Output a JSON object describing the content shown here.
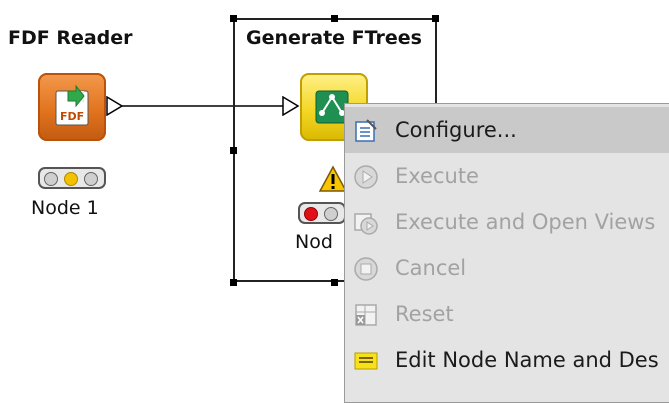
{
  "nodes": [
    {
      "title": "FDF Reader",
      "label": "Node 1",
      "icon_text": "FDF"
    },
    {
      "title": "Generate FTrees",
      "label_visible": "Nod"
    }
  ],
  "context_menu": {
    "items": [
      {
        "label": "Configure...",
        "icon": "configure-icon",
        "enabled": true,
        "highlighted": true
      },
      {
        "label": "Execute",
        "icon": "execute-icon",
        "enabled": false
      },
      {
        "label": "Execute and Open Views",
        "icon": "execute-open-views-icon",
        "enabled": false
      },
      {
        "label": "Cancel",
        "icon": "cancel-icon",
        "enabled": false
      },
      {
        "label": "Reset",
        "icon": "reset-icon",
        "enabled": false
      },
      {
        "label": "Edit Node Name and Des",
        "icon": "edit-comment-icon",
        "enabled": true
      }
    ]
  },
  "colors": {
    "reader_icon": "#e2741f",
    "ftrees_icon": "#f4d726",
    "status_yellow": "#f2c200",
    "status_red": "#e0101b",
    "warning": "#f7c600"
  }
}
